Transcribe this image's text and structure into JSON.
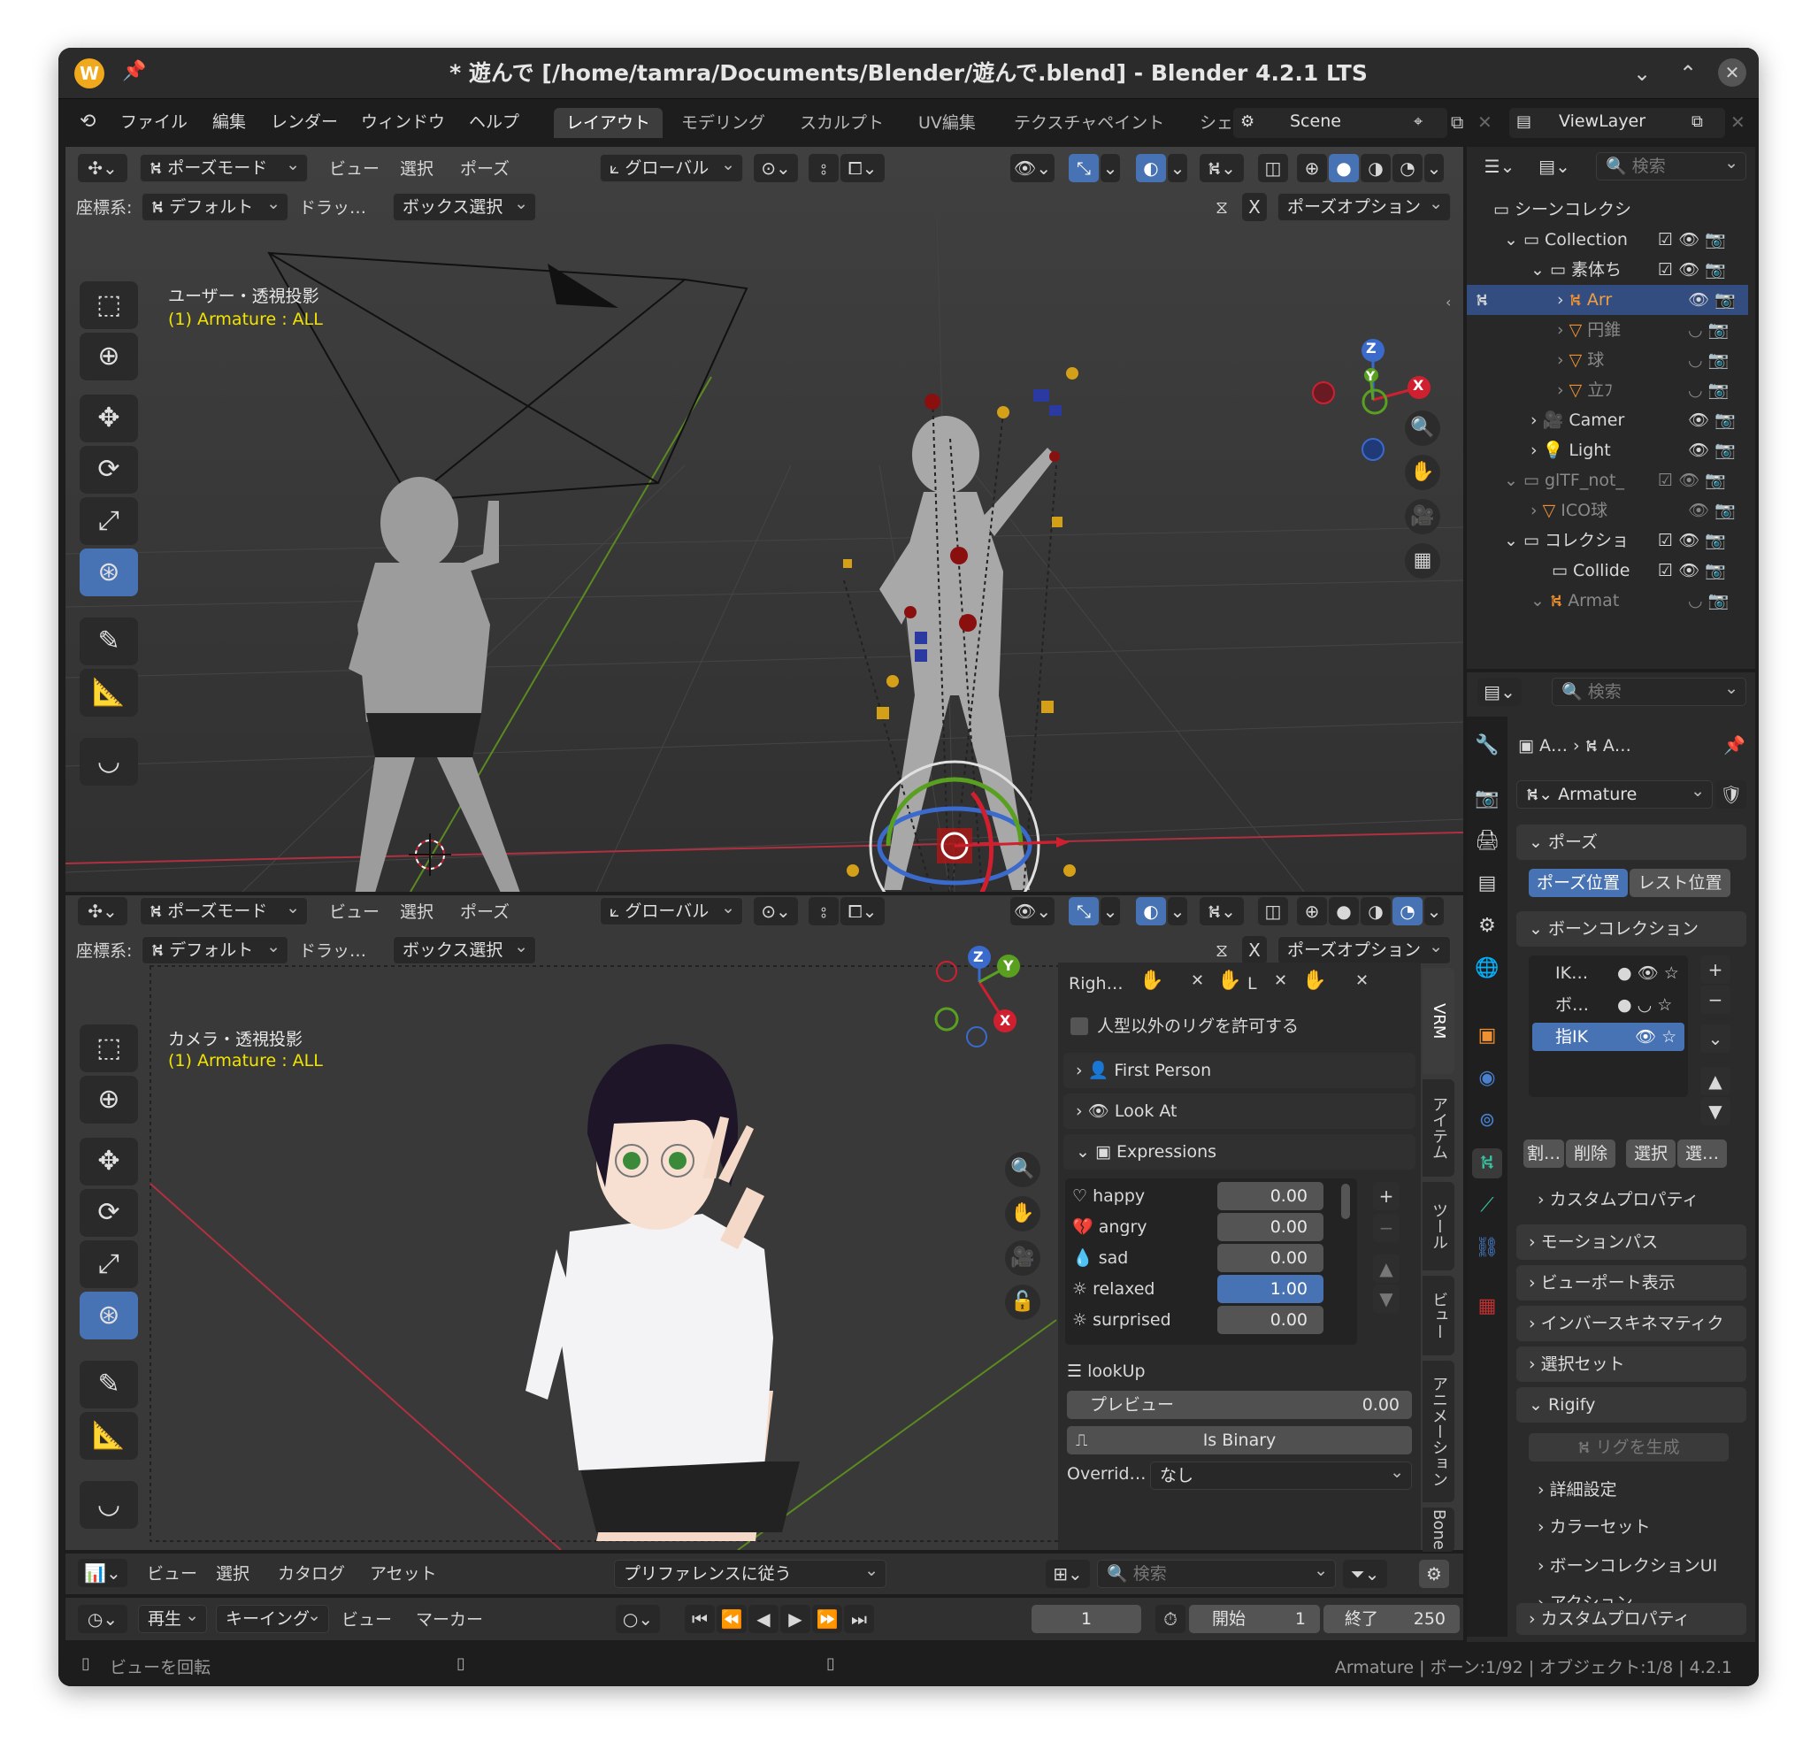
{
  "window": {
    "title": "* 遊んで [/home/tamra/Documents/Blender/遊んで.blend] - Blender 4.2.1 LTS"
  },
  "menu": {
    "items": [
      "ファイル",
      "編集",
      "レンダー",
      "ウィンドウ",
      "ヘルプ"
    ]
  },
  "workspaces": [
    "レイアウト",
    "モデリング",
    "スカルプト",
    "UV編集",
    "テクスチャペイント",
    "シェ"
  ],
  "scene": {
    "name": "Scene",
    "view_layer": "ViewLayer"
  },
  "viewport_header": {
    "mode": "ポーズモード",
    "view": "ビュー",
    "select": "選択",
    "pose": "ポーズ",
    "transform": "グローバル",
    "coord_label": "座標系:",
    "coord_value": "デフォルト",
    "drag_label": "ドラッ…",
    "drag_value": "ボックス選択",
    "pose_options": "ポーズオプション"
  },
  "viewport_top": {
    "projection": "ユーザー・透視投影",
    "object": "(1) Armature : ALL"
  },
  "viewport_bottom": {
    "projection": "カメラ・透視投影",
    "object": "(1) Armature : ALL"
  },
  "gizmo": {
    "x": "X",
    "y": "Y",
    "z": "Z"
  },
  "vrm": {
    "hands_label": "Righ…",
    "l_label": "L",
    "allow_non_human": "人型以外のリグを許可する",
    "first_person": "First Person",
    "look_at": "Look At",
    "expressions": "Expressions",
    "expr_list": [
      {
        "name": "happy",
        "value": "0.00"
      },
      {
        "name": "angry",
        "value": "0.00"
      },
      {
        "name": "sad",
        "value": "0.00"
      },
      {
        "name": "relaxed",
        "value": "1.00"
      },
      {
        "name": "surprised",
        "value": "0.00"
      }
    ],
    "selected_expression": "lookUp",
    "preview_label": "プレビュー",
    "preview_value": "0.00",
    "is_binary": "Is Binary",
    "override_label": "Overrid…",
    "override_value": "なし"
  },
  "side_tabs": [
    "VRM",
    "アイテム",
    "ツール",
    "ビュー",
    "アニメーション",
    "Bone P"
  ],
  "outliner": {
    "search_placeholder": "検索",
    "rows": [
      {
        "label": "シーンコレクシ"
      },
      {
        "label": "Collection"
      },
      {
        "label": "素体ち"
      },
      {
        "label": "Arr"
      },
      {
        "label": "円錐"
      },
      {
        "label": "球"
      },
      {
        "label": "立ﾌ"
      },
      {
        "label": "Camer"
      },
      {
        "label": "Light"
      },
      {
        "label": "glTF_not_"
      },
      {
        "label": "ICO球"
      },
      {
        "label": "コレクショ"
      },
      {
        "label": "Collide"
      },
      {
        "label": "Armat"
      }
    ]
  },
  "properties": {
    "search_placeholder": "検索",
    "breadcrumb_a": "A…",
    "breadcrumb_b": "A…",
    "object_name": "Armature",
    "pose_section": "ポーズ",
    "pose_position": "ポーズ位置",
    "rest_position": "レスト位置",
    "bone_collection": "ボーンコレクション",
    "bc_items": [
      "IK…",
      "ボ…",
      "指IK"
    ],
    "bc_buttons": [
      "割…",
      "削除",
      "選択",
      "選…"
    ],
    "custom_props": "カスタムプロパティ",
    "motion_path": "モーションパス",
    "viewport_display": "ビューポート表示",
    "ik": "インバースキネマティク",
    "selection_sets": "選択セット",
    "rigify": "Rigify",
    "generate_rig": "リグを生成",
    "advanced": "詳細設定",
    "color_sets": "カラーセット",
    "bone_collection_ui": "ボーンコレクションUI",
    "actions": "アクション",
    "custom_props2": "カスタムプロパティ"
  },
  "asset_bar": {
    "view": "ビュー",
    "select": "選択",
    "catalog": "カタログ",
    "asset": "アセット",
    "import": "プリファレンスに従う",
    "search_placeholder": "検索"
  },
  "timeline": {
    "play": "再生",
    "keying": "キーイング",
    "view": "ビュー",
    "marker": "マーカー",
    "current_frame": "1",
    "start_label": "開始",
    "start": "1",
    "end_label": "終了",
    "end": "250"
  },
  "status": {
    "left": "ビューを回転",
    "right": "Armature | ボーン:1/92 | オブジェクト:1/8 | 4.2.1"
  },
  "colors": {
    "accent": "#4772b3",
    "bg": "#1d1d1d",
    "viewport": "#3a3a3a",
    "header": "#303030"
  }
}
